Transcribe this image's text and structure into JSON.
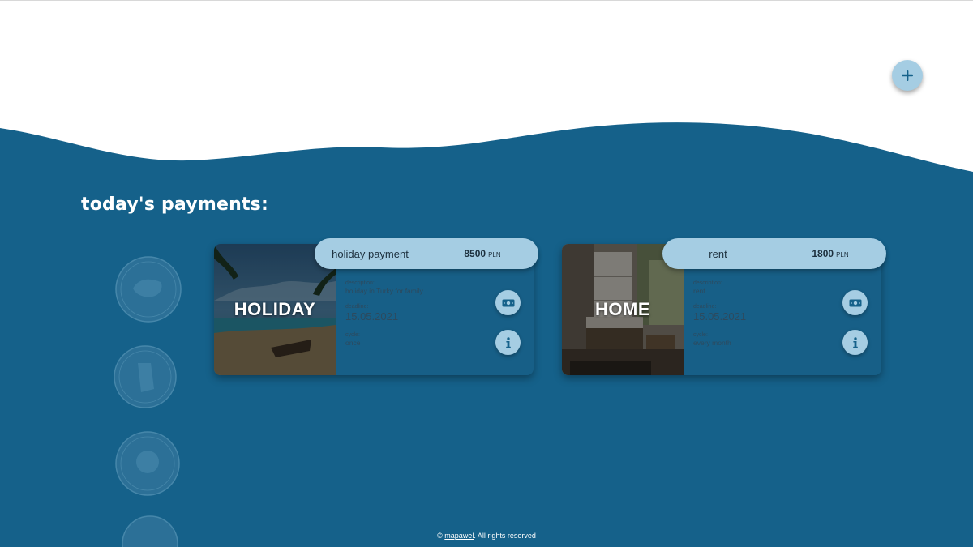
{
  "header": {
    "add_button_icon": "plus-icon"
  },
  "section": {
    "title": "today's payments:"
  },
  "colors": {
    "main_bg": "#15618a",
    "card_bg": "#175f87",
    "accent": "#a5cde3",
    "dark_text": "#1c2f3d"
  },
  "payments": [
    {
      "image_label": "HOLIDAY",
      "name": "holiday payment",
      "amount": "8500",
      "currency": "PLN",
      "description_label": "description:",
      "description": "holiday in Turky for family",
      "deadline_label": "deadline:",
      "deadline": "15.05.2021",
      "cycle_label": "cycle:",
      "cycle": "once",
      "pay_icon": "money-icon",
      "info_icon": "info-icon"
    },
    {
      "image_label": "HOME",
      "name": "rent",
      "amount": "1800",
      "currency": "PLN",
      "description_label": "description:",
      "description": "rent",
      "deadline_label": "deadline:",
      "deadline": "15.05.2021",
      "cycle_label": "cycle:",
      "cycle": "every month",
      "pay_icon": "money-icon",
      "info_icon": "info-icon"
    }
  ],
  "footer": {
    "copyright": "©",
    "author": "mapawel",
    "rights": ". All rights reserved"
  }
}
